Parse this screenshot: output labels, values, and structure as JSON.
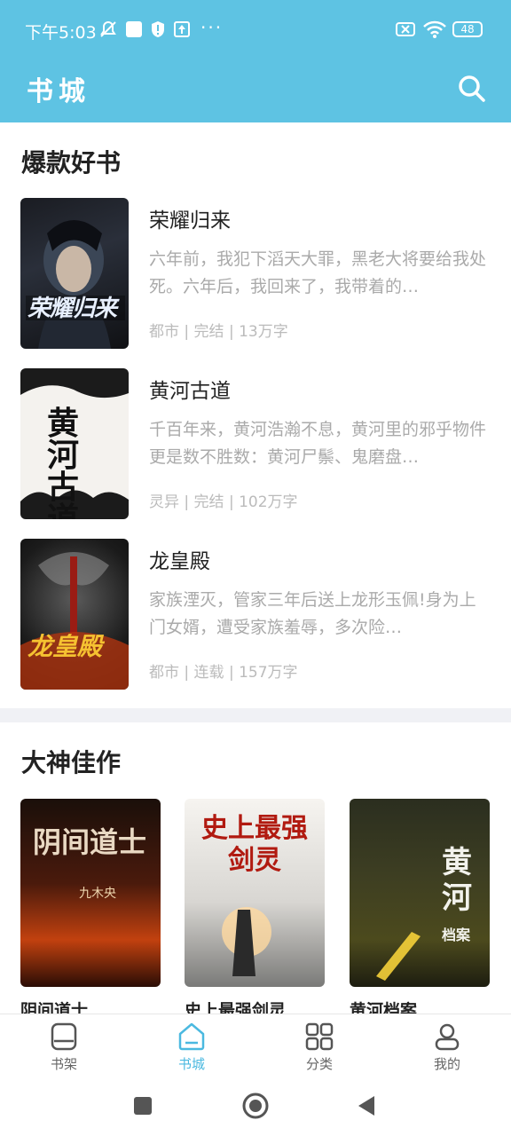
{
  "status_bar": {
    "time": "下午5:03",
    "dots": "···",
    "battery": "48"
  },
  "header": {
    "title": "书城",
    "search_icon": "search-icon"
  },
  "sections": {
    "hot": {
      "title": "爆款好书",
      "books": [
        {
          "name": "荣耀归来",
          "desc": "六年前，我犯下滔天大罪，黑老大将要给我处死。六年后，我回来了，我带着的…",
          "meta": "都市 | 完结 | 13万字",
          "cover_title": "荣耀归来"
        },
        {
          "name": "黄河古道",
          "desc": "千百年来，黄河浩瀚不息，黄河里的邪乎物件更是数不胜数：黄河尸鬃、鬼磨盘…",
          "meta": "灵异 | 完结 | 102万字",
          "cover_title": "黄河古道"
        },
        {
          "name": "龙皇殿",
          "desc": "家族湮灭，管家三年后送上龙形玉佩!身为上门女婿，遭受家族羞辱，多次险…",
          "meta": "都市 | 连载 | 157万字",
          "cover_title": "龙皇殿"
        }
      ]
    },
    "master": {
      "title": "大神佳作",
      "books": [
        {
          "name": "阴间道士",
          "cover_title": "阴间道士",
          "cover_author": "九木央"
        },
        {
          "name": "史上最强剑灵",
          "cover_title": "史上最强剑灵"
        },
        {
          "name": "黄河档案",
          "cover_title": "黄河",
          "cover_sub": "档案"
        }
      ]
    }
  },
  "bottom_nav": [
    {
      "label": "书架",
      "icon": "bookshelf-icon",
      "active": false
    },
    {
      "label": "书城",
      "icon": "bookstore-icon",
      "active": true
    },
    {
      "label": "分类",
      "icon": "category-icon",
      "active": false
    },
    {
      "label": "我的",
      "icon": "profile-icon",
      "active": false
    }
  ],
  "colors": {
    "primary": "#5ec3e3",
    "active_tab": "#4bb9e0",
    "muted_text": "#aaaaaa",
    "divider": "#f0f1f5"
  }
}
